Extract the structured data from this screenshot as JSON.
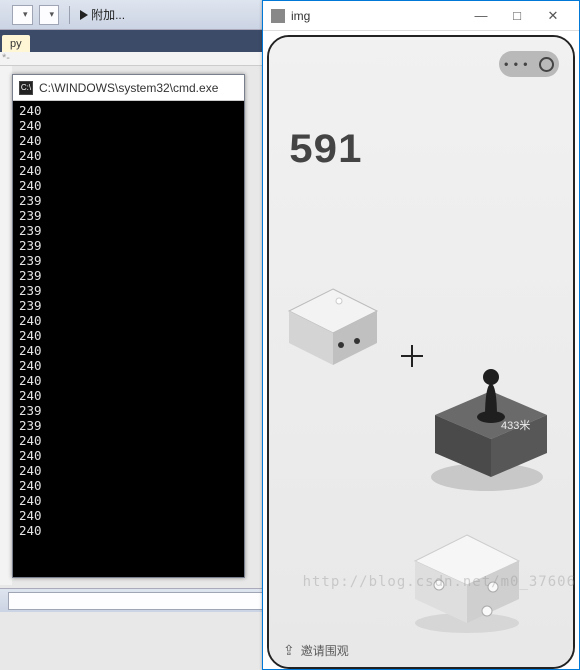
{
  "ide": {
    "dropdown1": "",
    "dropdown2": "",
    "run_label": "附加...",
    "tab_name": "py",
    "marker": "*-",
    "bottom_caret": "▾"
  },
  "cmd": {
    "title": "C:\\WINDOWS\\system32\\cmd.exe",
    "lines": [
      "240",
      "240",
      "240",
      "240",
      "240",
      "240",
      "239",
      "239",
      "239",
      "239",
      "239",
      "239",
      "239",
      "239",
      "240",
      "240",
      "240",
      "240",
      "240",
      "240",
      "239",
      "239",
      "240",
      "240",
      "240",
      "240",
      "240",
      "240",
      "240"
    ]
  },
  "img_window": {
    "title": "img",
    "minimize": "—",
    "maximize": "□",
    "close": "✕"
  },
  "game": {
    "score": "591",
    "box_label": "433米",
    "invite_label": "邀请围观",
    "pill_dots": "• • •"
  },
  "watermark": "http://blog.csdn.net/m0_37606"
}
